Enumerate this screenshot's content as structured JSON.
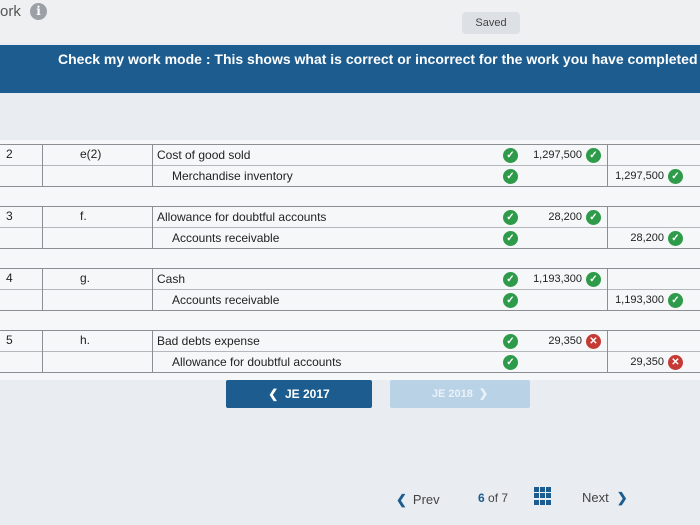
{
  "header": {
    "brand_text": "ork",
    "info_icon": "info-icon",
    "saved_label": "Saved"
  },
  "banner": {
    "prefix": "Check my work mode :",
    "text": "This shows what is correct or incorrect for the work you have completed so"
  },
  "rows": [
    {
      "no": "2",
      "event": "e(2)",
      "debit_account": "Cost of good sold",
      "credit_account": "Merchandise inventory",
      "debit_amount": "1,297,500",
      "credit_amount": "1,297,500",
      "debit_status": "correct",
      "credit_status": "correct"
    },
    {
      "no": "3",
      "event": "f.",
      "debit_account": "Allowance for doubtful accounts",
      "credit_account": "Accounts receivable",
      "debit_amount": "28,200",
      "credit_amount": "28,200",
      "debit_status": "correct",
      "credit_status": "correct"
    },
    {
      "no": "4",
      "event": "g.",
      "debit_account": "Cash",
      "credit_account": "Accounts receivable",
      "debit_amount": "1,193,300",
      "credit_amount": "1,193,300",
      "debit_status": "correct",
      "credit_status": "correct"
    },
    {
      "no": "5",
      "event": "h.",
      "debit_account": "Bad debts expense",
      "credit_account": "Allowance for doubtful accounts",
      "debit_amount": "29,350",
      "credit_amount": "29,350",
      "debit_status": "incorrect",
      "credit_status": "incorrect"
    }
  ],
  "nav": {
    "prev_je": "JE 2017",
    "next_je": "JE 2018"
  },
  "footer": {
    "prev": "Prev",
    "current": "6",
    "of": "of",
    "total": "7",
    "next": "Next"
  },
  "colors": {
    "accent": "#1d5c8f",
    "correct": "#2e9b4a",
    "incorrect": "#c63a35"
  }
}
